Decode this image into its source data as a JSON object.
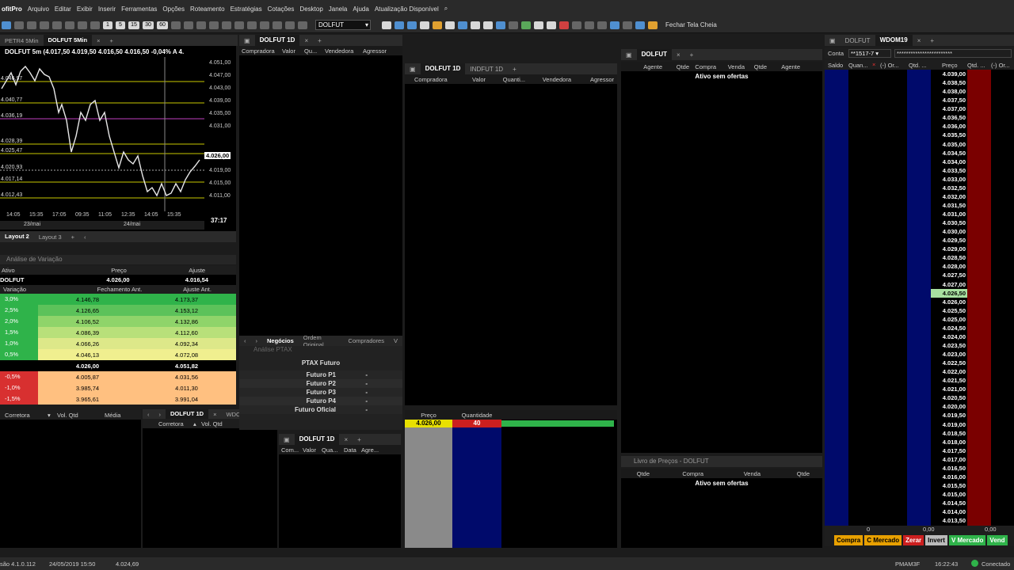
{
  "menubar": {
    "app": "ofitPro",
    "items": [
      "Arquivo",
      "Editar",
      "Exibir",
      "Inserir",
      "Ferramentas",
      "Opções",
      "Roteamento",
      "Estratégias",
      "Cotações",
      "Desktop",
      "Janela",
      "Ajuda",
      "Atualização Disponível"
    ]
  },
  "toolbar": {
    "symbol": "DOLFUT",
    "fullscreen": "Fechar Tela Cheia",
    "periods": [
      "1",
      "5",
      "15",
      "30",
      "60"
    ]
  },
  "chart": {
    "tabs": [
      "PETR4 5Min",
      "DOLFUT 5Min"
    ],
    "title": "DOLFUT 5m (4.017,50  4.019,50  4.016,50  4.016,50  -0,04%  A 4.",
    "price_axis": [
      "4.051,00",
      "4.047,00",
      "4.043,00",
      "4.039,00",
      "4.035,00",
      "4.031,00",
      "4.026,00",
      "4.023,00",
      "4.019,00",
      "4.015,00",
      "4.011,00"
    ],
    "levels": [
      "4.046,97",
      "4.040,77",
      "4.036,19",
      "4.028,39",
      "4.025,47",
      "4.020,93",
      "4.017,14",
      "4.012,43"
    ],
    "time_axis": [
      "14:05",
      "15:35",
      "17:05",
      "09:35",
      "11:05",
      "12:35",
      "14:05",
      "15:35"
    ],
    "dates": [
      "23/mai",
      "24/mai"
    ],
    "timer": "37:17",
    "layouts": [
      "Layout 2",
      "Layout 3"
    ]
  },
  "analise": {
    "title": "Análise de Variação",
    "h1": [
      "Ativo",
      "Preço",
      "Ajuste"
    ],
    "asset": [
      "DOLFUT",
      "4.026,00",
      "4.016,54"
    ],
    "h2": [
      "Variação",
      "Fechamento Ant.",
      "Ajuste Ant."
    ],
    "rows": [
      [
        "3,0%",
        "4.146,78",
        "4.173,37"
      ],
      [
        "2,5%",
        "4.126,65",
        "4.153,12"
      ],
      [
        "2,0%",
        "4.106,52",
        "4.132,86"
      ],
      [
        "1,5%",
        "4.086,39",
        "4.112,60"
      ],
      [
        "1,0%",
        "4.066,26",
        "4.092,34"
      ],
      [
        "0,5%",
        "4.046,13",
        "4.072,08"
      ],
      [
        "",
        "4.026,00",
        "4.051,82"
      ],
      [
        "-0,5%",
        "4.005,87",
        "4.031,56"
      ],
      [
        "-1,0%",
        "3.985,74",
        "4.011,30"
      ],
      [
        "-1,5%",
        "3.965,61",
        "3.991,04"
      ]
    ]
  },
  "broker": {
    "cols": [
      "Corretora",
      "Vol. Qtd",
      "Média"
    ]
  },
  "broker2": {
    "tab": "DOLFUT 1D",
    "tab2": "WDC",
    "cols": [
      "Corretora",
      "Vol. Qtd"
    ]
  },
  "ticker": {
    "tab": "DOLFUT 1D",
    "cols": [
      "Compradora",
      "Valor",
      "Qu...",
      "Vendedora",
      "Agressor"
    ],
    "subtabs": [
      "Negócios",
      "Ordem Original",
      "Compradores",
      "V"
    ]
  },
  "ptax": {
    "title": "Análise PTAX",
    "head": "PTAX Futuro",
    "rows": [
      [
        "Futuro P1",
        "-"
      ],
      [
        "Futuro P2",
        "-"
      ],
      [
        "Futuro P3",
        "-"
      ],
      [
        "Futuro P4",
        "-"
      ],
      [
        "Futuro Oficial",
        "-"
      ]
    ]
  },
  "tt3": {
    "tab": "DOLFUT 1D",
    "cols": [
      "Com...",
      "Valor",
      "Qua...",
      "Data",
      "Agre..."
    ]
  },
  "ticker2": {
    "tabs": [
      "DOLFUT 1D",
      "INDFUT 1D"
    ],
    "cols": [
      "Compradora",
      "Valor",
      "Quanti...",
      "Vendedora",
      "Agressor"
    ]
  },
  "volume": {
    "cols": [
      "Preço",
      "Quantidade"
    ],
    "price": "4.026,00",
    "qty": "40"
  },
  "book": {
    "tab": "DOLFUT",
    "cols": [
      "Agente",
      "Qtde",
      "Compra",
      "Venda",
      "Qtde",
      "Agente"
    ],
    "empty": "Ativo sem ofertas"
  },
  "livro": {
    "title": "Livro de Preços - DOLFUT",
    "cols": [
      "Qtde",
      "Compra",
      "Venda",
      "Qtde"
    ],
    "empty": "Ativo sem ofertas"
  },
  "dom": {
    "tabs": [
      "DOLFUT",
      "WDOM19"
    ],
    "conta_label": "Conta",
    "conta": "**1517-7",
    "senha": "************************",
    "cols": [
      "Saldo",
      "Quan...",
      "(-) Or...",
      "Qtd. ...",
      "Preço",
      "Qtd. ...",
      "(-) Or..."
    ],
    "prices": [
      "4.039,00",
      "4.038,50",
      "4.038,00",
      "4.037,50",
      "4.037,00",
      "4.036,50",
      "4.036,00",
      "4.035,50",
      "4.035,00",
      "4.034,50",
      "4.034,00",
      "4.033,50",
      "4.033,00",
      "4.032,50",
      "4.032,00",
      "4.031,50",
      "4.031,00",
      "4.030,50",
      "4.030,00",
      "4.029,50",
      "4.029,00",
      "4.028,50",
      "4.028,00",
      "4.027,50",
      "4.027,00",
      "4.026,50",
      "4.026,00",
      "4.025,50",
      "4.025,00",
      "4.024,50",
      "4.024,00",
      "4.023,50",
      "4.023,00",
      "4.022,50",
      "4.022,00",
      "4.021,50",
      "4.021,00",
      "4.020,50",
      "4.020,00",
      "4.019,50",
      "4.019,00",
      "4.018,50",
      "4.018,00",
      "4.017,50",
      "4.017,00",
      "4.016,50",
      "4.016,00",
      "4.015,50",
      "4.015,00",
      "4.014,50",
      "4.014,00",
      "4.013,50"
    ],
    "highlight": "4.026,50",
    "footer": [
      "0",
      "0,00",
      "0,00"
    ],
    "buttons": [
      "Compra",
      "C Mercado",
      "Zerar",
      "Invert",
      "V Mercado",
      "Vend"
    ]
  },
  "status": {
    "version": "são 4.1.0.112",
    "datetime": "24/05/2019 15:50",
    "price": "4.024,69",
    "server": "PMAM3F",
    "time": "16:22:43",
    "conn": "Conectado"
  },
  "colors": {
    "green": "#2fb34a",
    "red": "#cc1f1f",
    "yellow": "#e8e000",
    "navy": "#000a6b",
    "darkred": "#7a0000"
  }
}
